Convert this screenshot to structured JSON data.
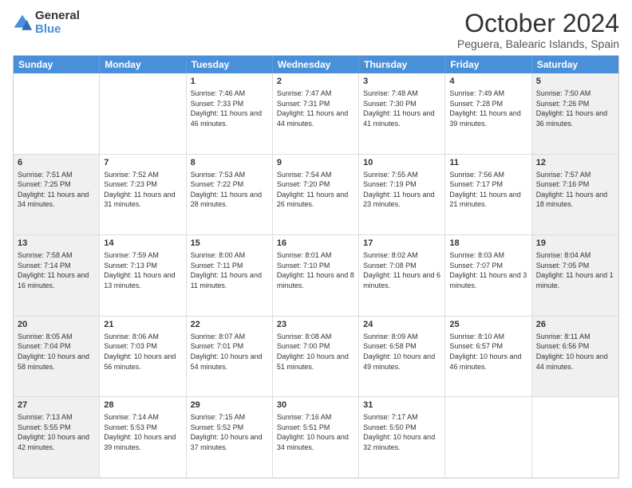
{
  "header": {
    "logo_line1": "General",
    "logo_line2": "Blue",
    "month_title": "October 2024",
    "location": "Peguera, Balearic Islands, Spain"
  },
  "day_headers": [
    "Sunday",
    "Monday",
    "Tuesday",
    "Wednesday",
    "Thursday",
    "Friday",
    "Saturday"
  ],
  "weeks": [
    [
      {
        "day": "",
        "info": "",
        "shaded": false,
        "empty": true
      },
      {
        "day": "",
        "info": "",
        "shaded": false,
        "empty": true
      },
      {
        "day": "1",
        "info": "Sunrise: 7:46 AM\nSunset: 7:33 PM\nDaylight: 11 hours and 46 minutes.",
        "shaded": false
      },
      {
        "day": "2",
        "info": "Sunrise: 7:47 AM\nSunset: 7:31 PM\nDaylight: 11 hours and 44 minutes.",
        "shaded": false
      },
      {
        "day": "3",
        "info": "Sunrise: 7:48 AM\nSunset: 7:30 PM\nDaylight: 11 hours and 41 minutes.",
        "shaded": false
      },
      {
        "day": "4",
        "info": "Sunrise: 7:49 AM\nSunset: 7:28 PM\nDaylight: 11 hours and 39 minutes.",
        "shaded": false
      },
      {
        "day": "5",
        "info": "Sunrise: 7:50 AM\nSunset: 7:26 PM\nDaylight: 11 hours and 36 minutes.",
        "shaded": true
      }
    ],
    [
      {
        "day": "6",
        "info": "Sunrise: 7:51 AM\nSunset: 7:25 PM\nDaylight: 11 hours and 34 minutes.",
        "shaded": true
      },
      {
        "day": "7",
        "info": "Sunrise: 7:52 AM\nSunset: 7:23 PM\nDaylight: 11 hours and 31 minutes.",
        "shaded": false
      },
      {
        "day": "8",
        "info": "Sunrise: 7:53 AM\nSunset: 7:22 PM\nDaylight: 11 hours and 28 minutes.",
        "shaded": false
      },
      {
        "day": "9",
        "info": "Sunrise: 7:54 AM\nSunset: 7:20 PM\nDaylight: 11 hours and 26 minutes.",
        "shaded": false
      },
      {
        "day": "10",
        "info": "Sunrise: 7:55 AM\nSunset: 7:19 PM\nDaylight: 11 hours and 23 minutes.",
        "shaded": false
      },
      {
        "day": "11",
        "info": "Sunrise: 7:56 AM\nSunset: 7:17 PM\nDaylight: 11 hours and 21 minutes.",
        "shaded": false
      },
      {
        "day": "12",
        "info": "Sunrise: 7:57 AM\nSunset: 7:16 PM\nDaylight: 11 hours and 18 minutes.",
        "shaded": true
      }
    ],
    [
      {
        "day": "13",
        "info": "Sunrise: 7:58 AM\nSunset: 7:14 PM\nDaylight: 11 hours and 16 minutes.",
        "shaded": true
      },
      {
        "day": "14",
        "info": "Sunrise: 7:59 AM\nSunset: 7:13 PM\nDaylight: 11 hours and 13 minutes.",
        "shaded": false
      },
      {
        "day": "15",
        "info": "Sunrise: 8:00 AM\nSunset: 7:11 PM\nDaylight: 11 hours and 11 minutes.",
        "shaded": false
      },
      {
        "day": "16",
        "info": "Sunrise: 8:01 AM\nSunset: 7:10 PM\nDaylight: 11 hours and 8 minutes.",
        "shaded": false
      },
      {
        "day": "17",
        "info": "Sunrise: 8:02 AM\nSunset: 7:08 PM\nDaylight: 11 hours and 6 minutes.",
        "shaded": false
      },
      {
        "day": "18",
        "info": "Sunrise: 8:03 AM\nSunset: 7:07 PM\nDaylight: 11 hours and 3 minutes.",
        "shaded": false
      },
      {
        "day": "19",
        "info": "Sunrise: 8:04 AM\nSunset: 7:05 PM\nDaylight: 11 hours and 1 minute.",
        "shaded": true
      }
    ],
    [
      {
        "day": "20",
        "info": "Sunrise: 8:05 AM\nSunset: 7:04 PM\nDaylight: 10 hours and 58 minutes.",
        "shaded": true
      },
      {
        "day": "21",
        "info": "Sunrise: 8:06 AM\nSunset: 7:03 PM\nDaylight: 10 hours and 56 minutes.",
        "shaded": false
      },
      {
        "day": "22",
        "info": "Sunrise: 8:07 AM\nSunset: 7:01 PM\nDaylight: 10 hours and 54 minutes.",
        "shaded": false
      },
      {
        "day": "23",
        "info": "Sunrise: 8:08 AM\nSunset: 7:00 PM\nDaylight: 10 hours and 51 minutes.",
        "shaded": false
      },
      {
        "day": "24",
        "info": "Sunrise: 8:09 AM\nSunset: 6:58 PM\nDaylight: 10 hours and 49 minutes.",
        "shaded": false
      },
      {
        "day": "25",
        "info": "Sunrise: 8:10 AM\nSunset: 6:57 PM\nDaylight: 10 hours and 46 minutes.",
        "shaded": false
      },
      {
        "day": "26",
        "info": "Sunrise: 8:11 AM\nSunset: 6:56 PM\nDaylight: 10 hours and 44 minutes.",
        "shaded": true
      }
    ],
    [
      {
        "day": "27",
        "info": "Sunrise: 7:13 AM\nSunset: 5:55 PM\nDaylight: 10 hours and 42 minutes.",
        "shaded": true
      },
      {
        "day": "28",
        "info": "Sunrise: 7:14 AM\nSunset: 5:53 PM\nDaylight: 10 hours and 39 minutes.",
        "shaded": false
      },
      {
        "day": "29",
        "info": "Sunrise: 7:15 AM\nSunset: 5:52 PM\nDaylight: 10 hours and 37 minutes.",
        "shaded": false
      },
      {
        "day": "30",
        "info": "Sunrise: 7:16 AM\nSunset: 5:51 PM\nDaylight: 10 hours and 34 minutes.",
        "shaded": false
      },
      {
        "day": "31",
        "info": "Sunrise: 7:17 AM\nSunset: 5:50 PM\nDaylight: 10 hours and 32 minutes.",
        "shaded": false
      },
      {
        "day": "",
        "info": "",
        "shaded": false,
        "empty": true
      },
      {
        "day": "",
        "info": "",
        "shaded": false,
        "empty": true
      }
    ]
  ]
}
